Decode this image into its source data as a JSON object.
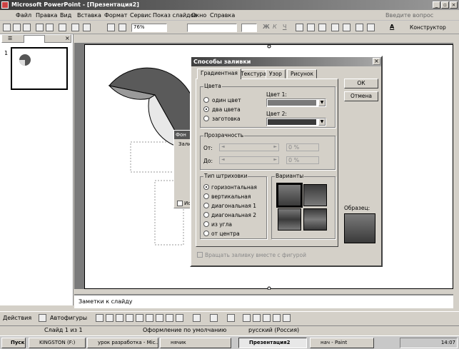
{
  "window": {
    "title": "Microsoft PowerPoint - [Презентация2]"
  },
  "menu": {
    "items": [
      "Файл",
      "Правка",
      "Вид",
      "Вставка",
      "Формат",
      "Сервис",
      "Показ слайдов",
      "Окно",
      "Справка"
    ],
    "help_box": "Введите вопрос"
  },
  "toolbar": {
    "zoom": "76%",
    "designer": "Конструктор"
  },
  "slides_pane": {
    "tabs_close": "×",
    "slide_number": "1"
  },
  "notes": {
    "text": "Заметки к слайду"
  },
  "drawbar": {
    "actions": "Действия",
    "autoshapes": "Автофигуры"
  },
  "status": {
    "slide": "Слайд 1 из 1",
    "design": "Оформление по умолчанию",
    "language": "русский (Россия)"
  },
  "taskbar": {
    "start": "Пуск",
    "items": [
      "KINGSTON (F:)",
      "урок разработка - Mic...",
      "нячик",
      "Презентация2",
      "нач - Paint"
    ],
    "clock": "14:07"
  },
  "background_dialog": {
    "title": "Фон",
    "group": "Зали",
    "checkbox": "Ис"
  },
  "fill_dialog": {
    "title": "Способы заливки",
    "close": "×",
    "tabs": [
      "Градиентная",
      "Текстура",
      "Узор",
      "Рисунок"
    ],
    "ok": "ОК",
    "cancel": "Отмена",
    "colors_group": "Цвета",
    "color_options": [
      "один цвет",
      "два цвета",
      "заготовка"
    ],
    "color1_label": "Цвет 1:",
    "color2_label": "Цвет 2:",
    "transparency_group": "Прозрачность",
    "from_label": "От:",
    "to_label": "До:",
    "from_value": "0 %",
    "to_value": "0 %",
    "hatch_group": "Тип штриховки",
    "hatch_options": [
      "горизонтальная",
      "вертикальная",
      "диагональная 1",
      "диагональная 2",
      "из угла",
      "от центра"
    ],
    "variants_group": "Варианты",
    "sample_label": "Образец:",
    "rotate_checkbox": "Вращать заливку вместе с фигурой",
    "color1": "#7a7a7a",
    "color2": "#3a3a3a",
    "selected_color_option": 1,
    "selected_hatch_option": 0
  }
}
